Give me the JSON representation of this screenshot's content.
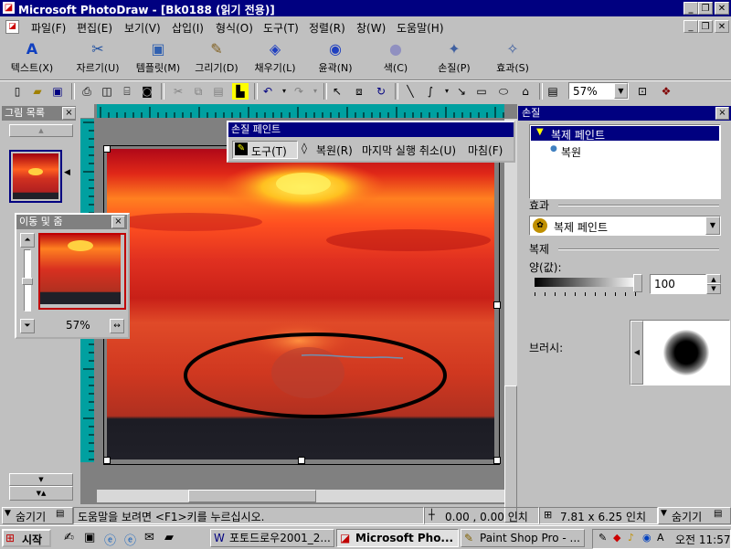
{
  "window": {
    "title": "Microsoft PhotoDraw - [Bk0188 (읽기 전용)]",
    "minimize": "_",
    "restore": "❐",
    "close": "✕"
  },
  "menu": [
    "파일(F)",
    "편집(E)",
    "보기(V)",
    "삽입(I)",
    "형식(O)",
    "도구(T)",
    "정렬(R)",
    "창(W)",
    "도움말(H)"
  ],
  "visual_toolbar": [
    {
      "label": "텍스트(X)",
      "icon": "A"
    },
    {
      "label": "자르기(U)",
      "icon": "✂"
    },
    {
      "label": "템플릿(M)",
      "icon": "▣"
    },
    {
      "label": "그리기(D)",
      "icon": "✎"
    },
    {
      "label": "채우기(L)",
      "icon": "◈"
    },
    {
      "label": "윤곽(N)",
      "icon": "◉"
    },
    {
      "label": "색(C)",
      "icon": "●"
    },
    {
      "label": "손질(P)",
      "icon": "✦"
    },
    {
      "label": "효과(S)",
      "icon": "✧"
    }
  ],
  "standard_toolbar": {
    "zoom": "57%"
  },
  "picture_list": {
    "title": "그림 목록",
    "close": "×"
  },
  "navigator": {
    "title": "이동 및 줌",
    "close": "×",
    "zoom_value": "57%"
  },
  "floating_toolbar": {
    "title": "손질 페인트",
    "items": [
      "도구(T)",
      "복원(R)",
      "마지막 실행 취소(U)",
      "마침(F)"
    ]
  },
  "right_panel": {
    "title": "손질",
    "close": "×",
    "tree_root": "복제 페인트",
    "tree_child": "복원",
    "effect_label": "효과",
    "effect_value": "복제 페인트",
    "clone_label": "복제",
    "amount_label": "양(값):",
    "amount_value": "100",
    "amount_level": 100,
    "brush_label": "브러시:"
  },
  "status": {
    "hide_left": "숨기기",
    "help_text": "도움말을 보려면 <F1>키를 누르십시오.",
    "coords": "0.00 , 0.00 인치",
    "size": "7.81 x 6.25 인치",
    "hide_right": "숨기기"
  },
  "taskbar": {
    "start": "시작",
    "buttons": [
      "포토드로우2001_2...",
      "Microsoft Pho...",
      "Paint Shop Pro - ..."
    ],
    "clock": "오전 11:57"
  },
  "colors": {
    "title_bar": "#000080",
    "face": "#c0c0c0",
    "ruler": "#00a0a0",
    "sky_top": "#c01010",
    "sun": "#ffd000",
    "water_dark": "#202028"
  }
}
